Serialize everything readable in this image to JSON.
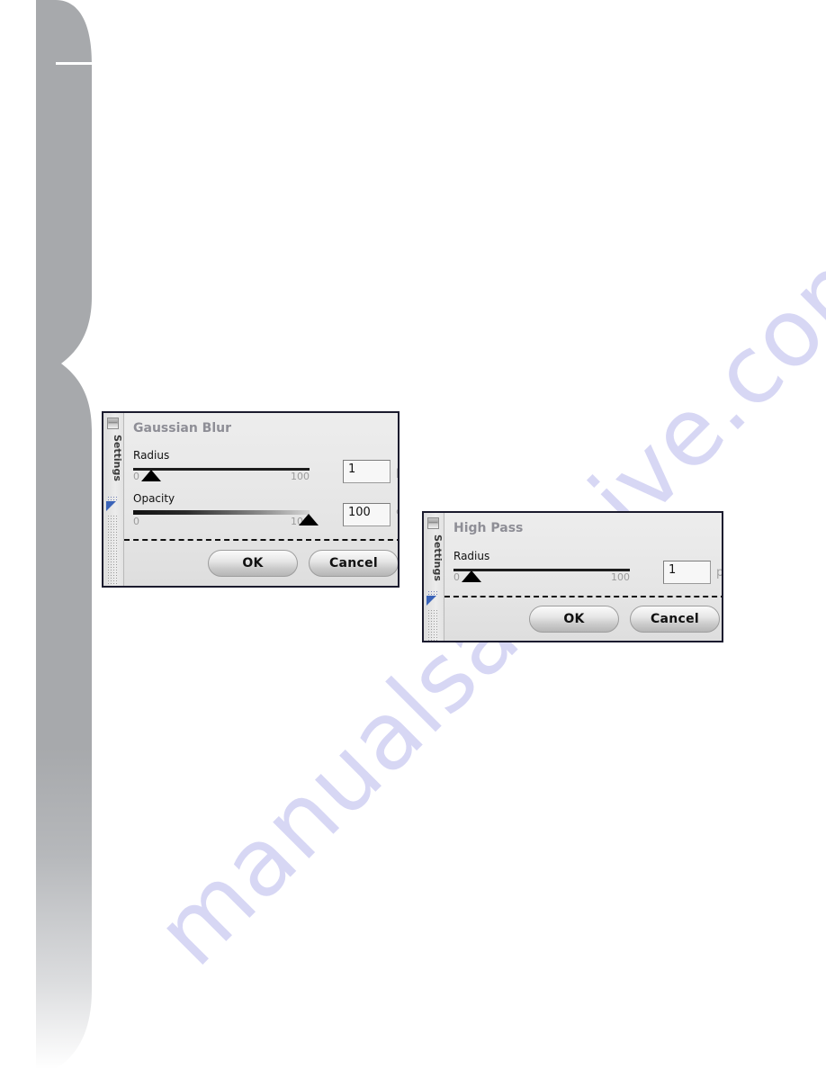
{
  "page": {
    "background_color": "#ffffff",
    "band_color": "#a7a9ac",
    "watermark_text": "manualsarchive.com",
    "watermark_color": "#ccccf2"
  },
  "dialogs": [
    {
      "id": "gaussian-blur",
      "title": "Gaussian Blur",
      "sidebar_label": "Settings",
      "icons": {
        "window_button": "minimize-box-icon",
        "marker": "blue-triangle-icon"
      },
      "fields": [
        {
          "label": "Radius",
          "slider": {
            "min_label": "0",
            "max_label": "100",
            "value": 1,
            "min": 0,
            "max": 100,
            "style": "plain"
          },
          "input_value": "1",
          "unit": "px"
        },
        {
          "label": "Opacity",
          "slider": {
            "min_label": "0",
            "max_label": "100",
            "value": 100,
            "min": 0,
            "max": 100,
            "style": "gradient"
          },
          "input_value": "100",
          "unit": "%"
        }
      ],
      "buttons": {
        "ok": "OK",
        "cancel": "Cancel"
      }
    },
    {
      "id": "high-pass",
      "title": "High Pass",
      "sidebar_label": "Settings",
      "icons": {
        "window_button": "minimize-box-icon",
        "marker": "blue-triangle-icon"
      },
      "fields": [
        {
          "label": "Radius",
          "slider": {
            "min_label": "0",
            "max_label": "100",
            "value": 1,
            "min": 0,
            "max": 100,
            "style": "plain"
          },
          "input_value": "1",
          "unit": "px"
        }
      ],
      "buttons": {
        "ok": "OK",
        "cancel": "Cancel"
      }
    }
  ]
}
